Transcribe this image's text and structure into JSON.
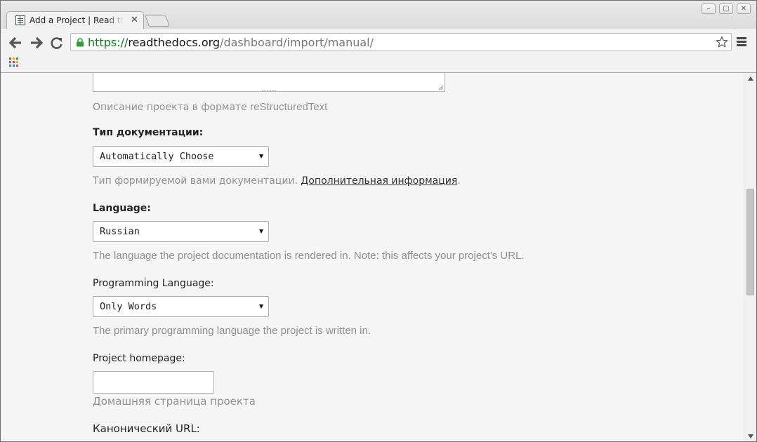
{
  "browser": {
    "tab_title": "Add a Project | Read the Docs",
    "url_scheme": "https://",
    "url_host": "readthedocs.org",
    "url_path": "/dashboard/import/manual/",
    "window_controls": [
      "minimize",
      "restore",
      "close"
    ]
  },
  "form": {
    "description_help_prefix": "Описание проекта в формате ",
    "description_help_format": "reStructuredText",
    "doc_type": {
      "label": "Тип документации:",
      "selected": "Automatically Choose",
      "help_text": "Тип формируемой вами документации. ",
      "help_link": "Дополнительная информация",
      "help_suffix": "."
    },
    "language": {
      "label": "Language:",
      "selected": "Russian",
      "help_text": "The language the project documentation is rendered in. Note: this affects your project's URL."
    },
    "programming_language": {
      "label": "Programming Language:",
      "selected": "Only Words",
      "help_text": "The primary programming language the project is written in."
    },
    "homepage": {
      "label": "Project homepage:",
      "value": "",
      "help_text": "Домашняя страница проекта"
    },
    "canonical_url": {
      "label": "Канонический URL:"
    }
  }
}
